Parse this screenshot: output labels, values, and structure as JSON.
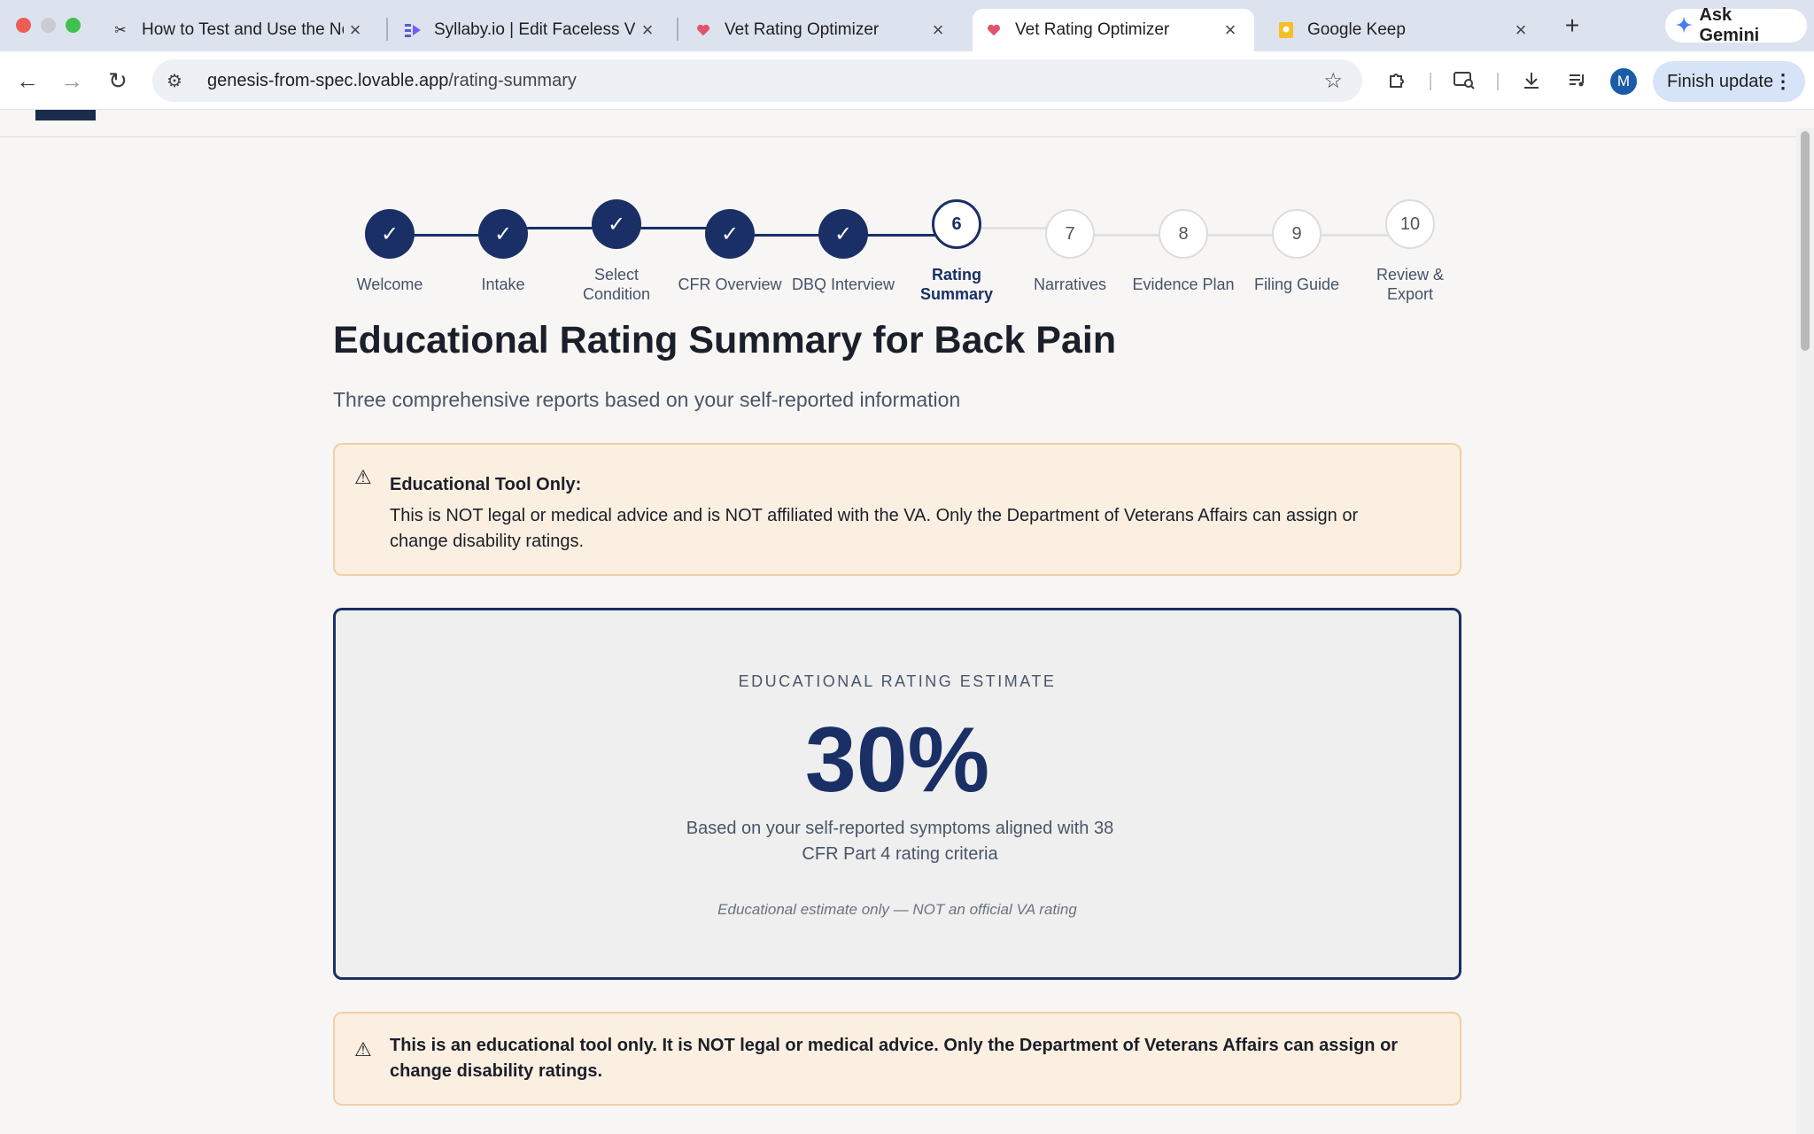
{
  "browser": {
    "tabs": [
      {
        "title": "How to Test and Use the No",
        "favicon": "scissors-icon",
        "active": false
      },
      {
        "title": "Syllaby.io | Edit Faceless Vid",
        "favicon": "syllaby-icon",
        "active": false
      },
      {
        "title": "Vet Rating Optimizer",
        "favicon": "heart-icon",
        "active": false
      },
      {
        "title": "Vet Rating Optimizer",
        "favicon": "heart-icon",
        "active": true
      },
      {
        "title": "Google Keep",
        "favicon": "keep-icon",
        "active": false
      }
    ],
    "ask_gemini": "Ask Gemini",
    "url_domain": "genesis-from-spec.lovable.app",
    "url_path": "/rating-summary",
    "profile_initial": "M",
    "finish_update": "Finish update"
  },
  "stepper": {
    "steps": [
      {
        "number": "",
        "label": "Welcome",
        "state": "done"
      },
      {
        "number": "",
        "label": "Intake",
        "state": "done"
      },
      {
        "number": "",
        "label": "Select Condition",
        "state": "done"
      },
      {
        "number": "",
        "label": "CFR Overview",
        "state": "done"
      },
      {
        "number": "",
        "label": "DBQ Interview",
        "state": "done"
      },
      {
        "number": "6",
        "label": "Rating Summary",
        "state": "current"
      },
      {
        "number": "7",
        "label": "Narratives",
        "state": "future"
      },
      {
        "number": "8",
        "label": "Evidence Plan",
        "state": "future"
      },
      {
        "number": "9",
        "label": "Filing Guide",
        "state": "future"
      },
      {
        "number": "10",
        "label": "Review & Export",
        "state": "future"
      }
    ]
  },
  "page": {
    "title": "Educational Rating Summary for Back Pain",
    "subtitle": "Three comprehensive reports based on your self-reported information",
    "notice_title": "Educational Tool Only:",
    "notice_text": "This is NOT legal or medical advice and is NOT affiliated with the VA. Only the Department of Veterans Affairs can assign or change disability ratings.",
    "rating_eyebrow": "EDUCATIONAL RATING ESTIMATE",
    "rating_value": "30%",
    "rating_basis": "Based on your self-reported symptoms aligned with 38 CFR Part 4 rating criteria",
    "rating_note": "Educational estimate only — NOT an official VA rating",
    "bottom_notice": "This is an educational tool only. It is NOT legal or medical advice. Only the Department of Veterans Affairs can assign or change disability ratings."
  },
  "colors": {
    "primary": "#1a2f66",
    "warning_bg": "#fbefe1",
    "warning_border": "#f1cfa8"
  }
}
